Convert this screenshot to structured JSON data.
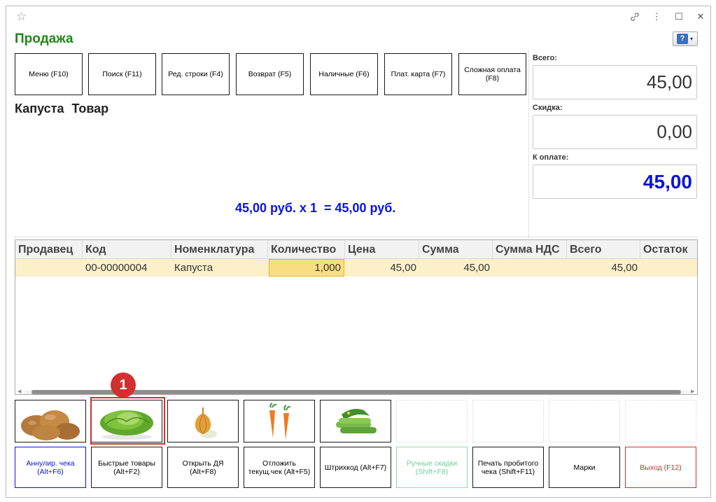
{
  "window": {
    "icons": [
      "star-icon",
      "link-icon",
      "more-icon",
      "maximize-icon",
      "close-icon"
    ],
    "controls": {
      "link": "🔗",
      "more": "⋮",
      "maximize": "☐",
      "close": "✕",
      "star": "☆"
    }
  },
  "header": {
    "title": "Продажа",
    "help_icon": "?",
    "help_dropdown": "▾"
  },
  "toolbar": [
    {
      "name": "menu",
      "label": "Меню (F10)"
    },
    {
      "name": "search",
      "label": "Поиск (F11)"
    },
    {
      "name": "edit-row",
      "label": "Ред. строки (F4)"
    },
    {
      "name": "return",
      "label": "Возврат (F5)"
    },
    {
      "name": "cash",
      "label": "Наличные (F6)"
    },
    {
      "name": "card",
      "label": "Плат. карта (F7)"
    },
    {
      "name": "complex-payment",
      "label": "Сложная оплата (F8)"
    }
  ],
  "product": {
    "name": "Капуста Товар",
    "calc": "45,00 руб. x 1  = 45,00 руб."
  },
  "totals": {
    "total_label": "Всего:",
    "total_value": "45,00",
    "discount_label": "Скидка:",
    "discount_value": "0,00",
    "to_pay_label": "К оплате:",
    "to_pay_value": "45,00",
    "accent_color": "#0a14d8"
  },
  "table": {
    "columns": [
      "Продавец",
      "Код",
      "Номенклатура",
      "Количество",
      "Цена",
      "Сумма",
      "Сумма НДС",
      "Всего",
      "Остаток"
    ],
    "rows": [
      {
        "seller": "",
        "code": "00-00000004",
        "item": "Капуста",
        "qty": "1,000",
        "price": "45,00",
        "sum": "45,00",
        "vat": "",
        "total": "45,00",
        "rest": ""
      }
    ]
  },
  "quick_items": [
    {
      "name": "potatoes",
      "icon": "potato-icon"
    },
    {
      "name": "cabbage",
      "icon": "cabbage-icon"
    },
    {
      "name": "onion",
      "icon": "onion-icon"
    },
    {
      "name": "carrots",
      "icon": "carrot-icon"
    },
    {
      "name": "cucumbers",
      "icon": "cucumber-icon"
    }
  ],
  "annotation": {
    "number": "1",
    "color": "#d32f2f"
  },
  "bottom_buttons": [
    {
      "name": "annul-check",
      "label": "Аннулир. чека (Alt+F6)",
      "color": "#0a14d8",
      "border": "#0a14d8"
    },
    {
      "name": "quick-goods",
      "label": "Быстрые товары (Alt+F2)",
      "color": "#000000",
      "border": "#1a1a1a"
    },
    {
      "name": "open-cash-drawer",
      "label": "Открыть ДЯ (Alt+F8)",
      "color": "#000000",
      "border": "#1a1a1a"
    },
    {
      "name": "postpone-check",
      "label": "Отложить текущ.чек (Alt+F5)",
      "color": "#000000",
      "border": "#1a1a1a"
    },
    {
      "name": "barcode",
      "label": "Штрихкод (Alt+F7)",
      "color": "#000000",
      "border": "#1a1a1a"
    },
    {
      "name": "manual-discounts",
      "label": "Ручные скидки (Shift+F8)",
      "color": "#6fcf97",
      "border": "#8fd9ae"
    },
    {
      "name": "print-check",
      "label": "Печать пробитого чека (Shift+F11)",
      "color": "#000000",
      "border": "#1a1a1a"
    },
    {
      "name": "marks",
      "label": "Марки",
      "color": "#000000",
      "border": "#1a1a1a"
    },
    {
      "name": "exit",
      "label": "Выход (F12)",
      "color": "#d32f2f",
      "border": "#d32f2f"
    }
  ]
}
